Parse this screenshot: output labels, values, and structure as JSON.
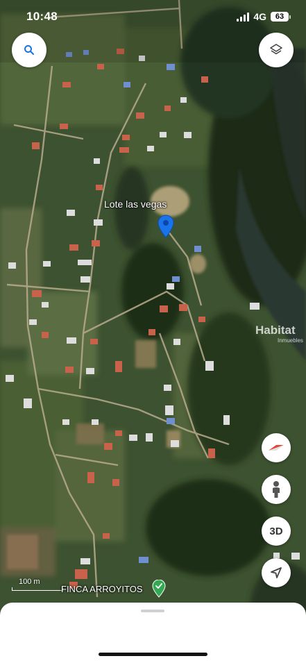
{
  "status_bar": {
    "time": "10:48",
    "network": "4G",
    "battery": "63"
  },
  "map": {
    "pin_label": "Lote las vegas",
    "place_label": "FINCA ARROYITOS",
    "scale_label": "100 m",
    "watermark": {
      "brand": "Habitat",
      "sub": "Inmuebles"
    }
  },
  "controls": {
    "button_3d": "3D"
  },
  "colors": {
    "pin": "#1a73e8",
    "place_pin": "#34a853",
    "compass_red": "#ea4335"
  }
}
